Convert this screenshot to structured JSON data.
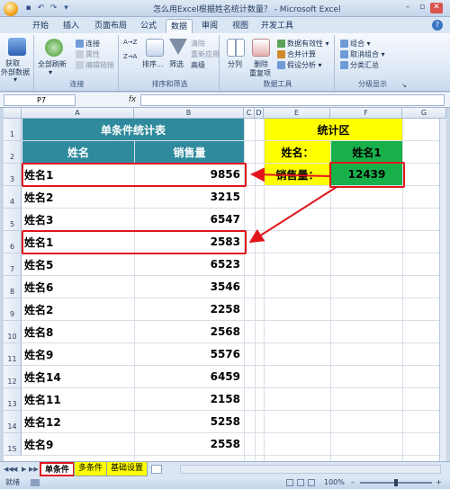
{
  "window": {
    "title": "怎么用Excel根据姓名统计数量？ - Microsoft Excel",
    "buttons": {
      "minimize": "–",
      "restore": "▫",
      "close": "✕"
    }
  },
  "quick_access": {
    "save_icon": "save-icon",
    "undo": "↶",
    "redo": "↷",
    "customize": "▾"
  },
  "tabs": [
    "开始",
    "插入",
    "页面布局",
    "公式",
    "数据",
    "审阅",
    "视图",
    "开发工具"
  ],
  "active_tab": "数据",
  "help_glyph": "?",
  "ribbon": {
    "get_external": {
      "line1": "获取",
      "line2": "外部数据",
      "arrow": "▾"
    },
    "refresh_all": {
      "label": "全部刷新",
      "arrow": "▾"
    },
    "connections": [
      "连接",
      "属性",
      "编辑链接"
    ],
    "connections_group": "连接",
    "sort_asc": "A→Z",
    "sort_desc": "Z→A",
    "sort_btn": "排序...",
    "filter_btn": "筛选",
    "filter_small": [
      "清除",
      "重新应用",
      "高级"
    ],
    "sort_group": "排序和筛选",
    "text_to_cols": "分列",
    "remove_dup": {
      "line1": "删除",
      "line2": "重复项"
    },
    "data_tools_small": [
      "数据有效性 ▾",
      "合并计算",
      "假设分析 ▾"
    ],
    "data_tools_group": "数据工具",
    "outline_small": [
      "组合 ▾",
      "取消组合 ▾",
      "分类汇总"
    ],
    "outline_group": "分级显示",
    "launcher": "↘"
  },
  "formula_bar": {
    "name_box": "P7",
    "fx": "fx",
    "formula": ""
  },
  "columns": [
    "A",
    "B",
    "C",
    "D",
    "E",
    "F",
    "G"
  ],
  "rows": [
    "1",
    "2",
    "3",
    "4",
    "5",
    "6",
    "7",
    "8",
    "9",
    "10",
    "11",
    "12",
    "13",
    "14",
    "15"
  ],
  "table": {
    "title": "单条件统计表",
    "header_name": "姓名",
    "header_sales": "销售量",
    "records": [
      {
        "name": "姓名1",
        "sales": "9856"
      },
      {
        "name": "姓名2",
        "sales": "3215"
      },
      {
        "name": "姓名3",
        "sales": "6547"
      },
      {
        "name": "姓名1",
        "sales": "2583"
      },
      {
        "name": "姓名5",
        "sales": "6523"
      },
      {
        "name": "姓名6",
        "sales": "3546"
      },
      {
        "name": "姓名2",
        "sales": "2258"
      },
      {
        "name": "姓名8",
        "sales": "2568"
      },
      {
        "name": "姓名9",
        "sales": "5576"
      },
      {
        "name": "姓名14",
        "sales": "6459"
      },
      {
        "name": "姓名11",
        "sales": "2158"
      },
      {
        "name": "姓名12",
        "sales": "5258"
      },
      {
        "name": "姓名9",
        "sales": "2558"
      }
    ]
  },
  "stats": {
    "title": "统计区",
    "name_label": "姓名：",
    "name_value": "姓名1",
    "sales_label": "销售量：",
    "sales_value": "12439"
  },
  "colors": {
    "teal": "#2e8a9c",
    "yellow": "#ffff00",
    "green": "#17b04a",
    "red": "#e0161b"
  },
  "sheet_tabs": [
    "单条件",
    "多条件",
    "基础设置"
  ],
  "active_sheet": "单条件",
  "sheet_nav": [
    "◀◀",
    "◀",
    "▶",
    "▶▶"
  ],
  "new_sheet_icon": "new-sheet-icon",
  "status": {
    "ready": "就绪",
    "zoom": "100%",
    "zoom_minus": "–",
    "zoom_plus": "+"
  }
}
